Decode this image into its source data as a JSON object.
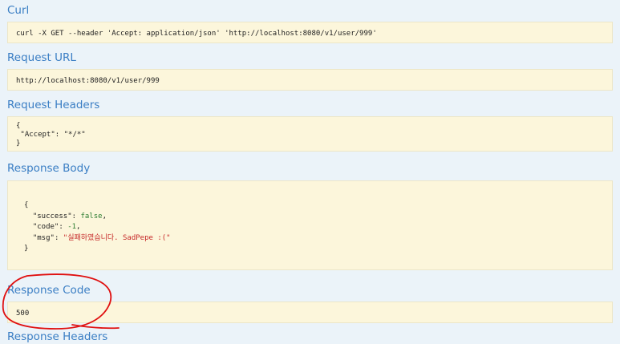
{
  "sections": {
    "curl": {
      "title": "Curl",
      "command": "curl -X GET --header 'Accept: application/json' 'http://localhost:8080/v1/user/999'"
    },
    "request_url": {
      "title": "Request URL",
      "value": "http://localhost:8080/v1/user/999"
    },
    "request_headers": {
      "title": "Request Headers",
      "open": "{",
      "accept_key": "\"Accept\"",
      "accept_value": "\"*/*\"",
      "close": "}"
    },
    "response_body": {
      "title": "Response Body",
      "open": "{",
      "success_key": "\"success\"",
      "success_value": "false",
      "code_key": "\"code\"",
      "code_value": "-1",
      "msg_key": "\"msg\"",
      "msg_value": "\"실패하였습니다. SadPepe :(\"",
      "close": "}"
    },
    "response_code": {
      "title": "Response Code",
      "value": "500"
    },
    "response_headers": {
      "title": "Response Headers"
    }
  },
  "colors": {
    "background": "#ebf3f9",
    "title": "#3a7ec4",
    "code_background": "#fcf6db",
    "annotation": "#e01010"
  }
}
